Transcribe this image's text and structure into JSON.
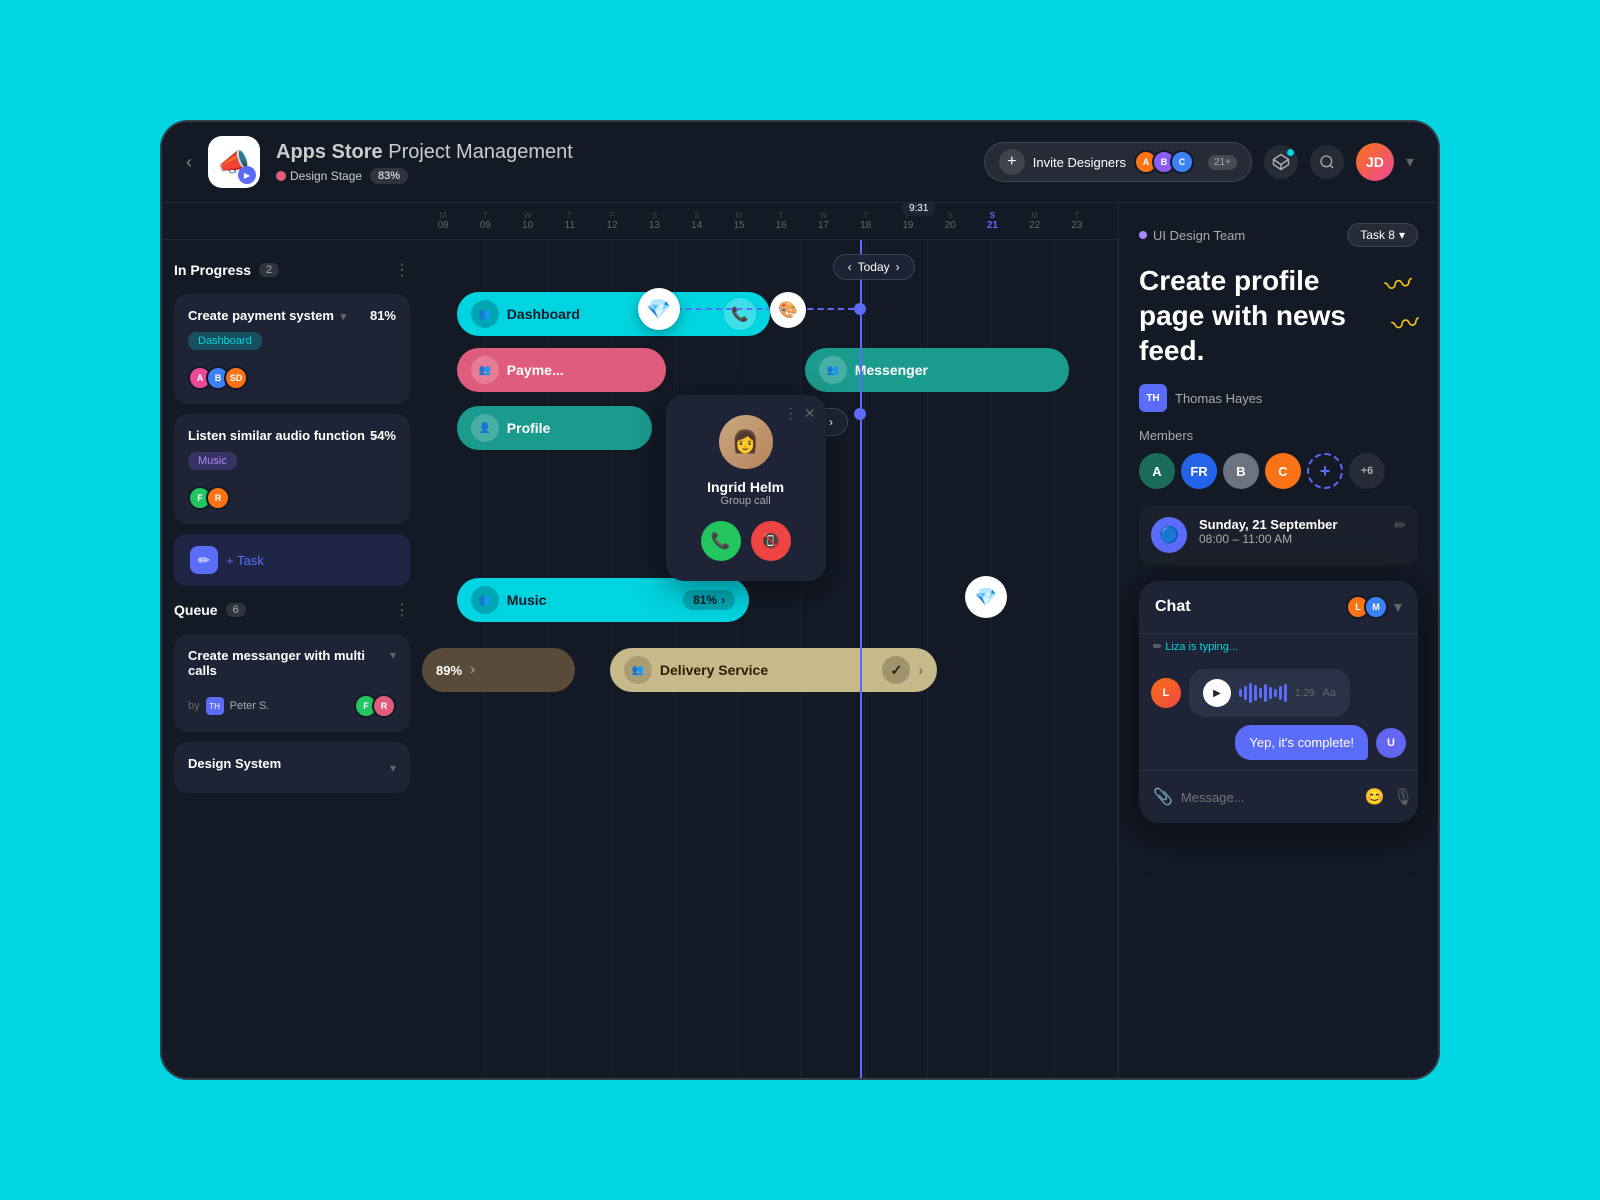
{
  "app": {
    "title_bold": "Apps Store",
    "title_normal": " Project Management",
    "badge_stage": "Design Stage",
    "badge_percent": "83%",
    "back_label": "‹"
  },
  "header": {
    "invite_label": "Invite Designers",
    "plus_label": "+",
    "count_badge": "21+",
    "time_display": "9:31"
  },
  "timeline": {
    "dates": [
      {
        "day": "M",
        "num": "08"
      },
      {
        "day": "T",
        "num": "09"
      },
      {
        "day": "W",
        "num": "10"
      },
      {
        "day": "T",
        "num": "11"
      },
      {
        "day": "F",
        "num": "12"
      },
      {
        "day": "S",
        "num": "13"
      },
      {
        "day": "S",
        "num": "14"
      },
      {
        "day": "M",
        "num": "15"
      },
      {
        "day": "T",
        "num": "16"
      },
      {
        "day": "W",
        "num": "17"
      },
      {
        "day": "T",
        "num": "18"
      },
      {
        "day": "F",
        "num": "19"
      },
      {
        "day": "S",
        "num": "20"
      },
      {
        "day": "S",
        "num": "21",
        "active": true
      },
      {
        "day": "M",
        "num": "22"
      },
      {
        "day": "T",
        "num": "23"
      }
    ],
    "today_btn": "Today"
  },
  "sections": {
    "in_progress": {
      "label": "In Progress",
      "count": "2"
    },
    "queue": {
      "label": "Queue",
      "count": "6"
    }
  },
  "tasks": [
    {
      "title": "Create payment system",
      "percent": "81%",
      "tag": "Dashboard",
      "tag_color": "cyan"
    },
    {
      "title": "Listen similar audio function",
      "percent": "54%",
      "tag": "Music",
      "tag_color": "purple"
    },
    {
      "title": "Create messanger with multi calls",
      "by_label": "by",
      "author": "Peter S."
    },
    {
      "title": "Design System"
    }
  ],
  "add_task_label": "+ Task",
  "gantt_bars": [
    {
      "label": "Dashboard",
      "color": "cyan"
    },
    {
      "label": "Payment",
      "color": "pink"
    },
    {
      "label": "Messenger",
      "color": "teal"
    },
    {
      "label": "Profile",
      "color": "teal"
    },
    {
      "label": "Music",
      "color": "cyan",
      "percent": "81%"
    },
    {
      "label": "Delivery Service",
      "color": "beige",
      "check": true
    }
  ],
  "call_popup": {
    "name": "Ingrid Helm",
    "status": "Group call",
    "accept_label": "📞",
    "decline_label": "📵"
  },
  "right_panel": {
    "team_label": "UI Design Team",
    "task_label": "Task 8",
    "task_chevron": "▾",
    "page_title": "Create profile page with news feed.",
    "author": "Thomas Hayes",
    "author_initials": "TH",
    "members_label": "Members",
    "schedule_date": "Sunday, 21 September",
    "schedule_time": "08:00 – 11:00 AM"
  },
  "chat": {
    "title": "Chat",
    "typing_text": "Liza is typing...",
    "audio_time": "1:29",
    "aa_label": "Aa",
    "message_placeholder": "Message...",
    "sent_message": "Yep, it's complete!",
    "send_icon": "➤"
  }
}
